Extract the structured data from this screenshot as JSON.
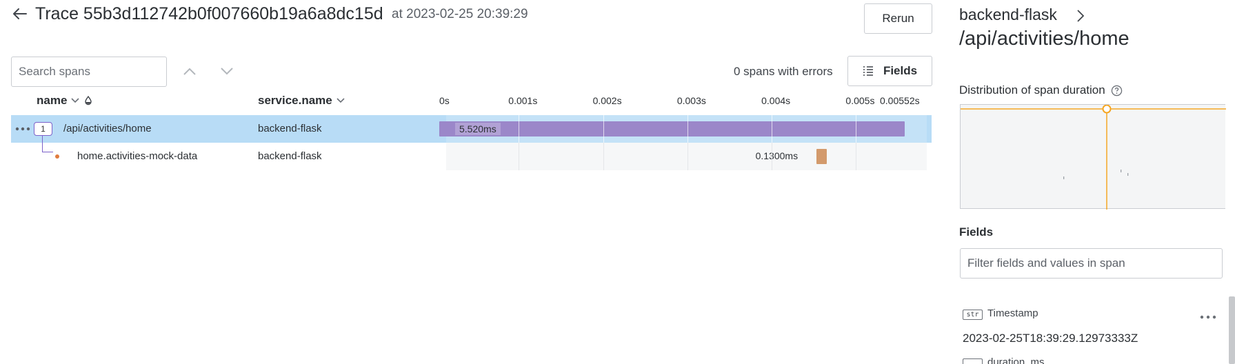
{
  "header": {
    "title": "Trace 55b3d112742b0f007660b19a6a8dc15d",
    "timestamp": "at 2023-02-25 20:39:29",
    "rerun_label": "Rerun",
    "back_icon": "arrow-left-icon"
  },
  "toolbar": {
    "search_placeholder": "Search spans",
    "errors_text": "0 spans with errors",
    "fields_label": "Fields",
    "fields_icon": "list-icon"
  },
  "columns": {
    "name": "name",
    "service": "service.name"
  },
  "timeline": {
    "max_seconds": 0.00552,
    "ticks": [
      {
        "label": "0s",
        "value": 0
      },
      {
        "label": "0.001s",
        "value": 0.001
      },
      {
        "label": "0.002s",
        "value": 0.002
      },
      {
        "label": "0.003s",
        "value": 0.003
      },
      {
        "label": "0.004s",
        "value": 0.004
      },
      {
        "label": "0.005s",
        "value": 0.005
      },
      {
        "label": "0.00552s",
        "value": 0.00552
      }
    ]
  },
  "spans": [
    {
      "name": "/api/activities/home",
      "service": "backend-flask",
      "child_count": "1",
      "duration_label": "5.520ms",
      "start_ms": 0,
      "duration_ms": 5.52,
      "color": "#9b87c9",
      "selected": true
    },
    {
      "name": "home.activities-mock-data",
      "service": "backend-flask",
      "duration_label": "0.1300ms",
      "start_ms": 4.47,
      "duration_ms": 0.13,
      "color": "#d39a6c",
      "selected": false
    }
  ],
  "details": {
    "service_name": "backend-flask",
    "span_name": "/api/activities/home",
    "distribution_title": "Distribution of span duration",
    "fields_title": "Fields",
    "filter_placeholder": "Filter fields and values in span",
    "field": {
      "type": "str",
      "key": "Timestamp",
      "value": "2023-02-25T18:39:29.12973333Z"
    },
    "next_field_key": "duration_ms",
    "accent_color": "#f5a623"
  }
}
